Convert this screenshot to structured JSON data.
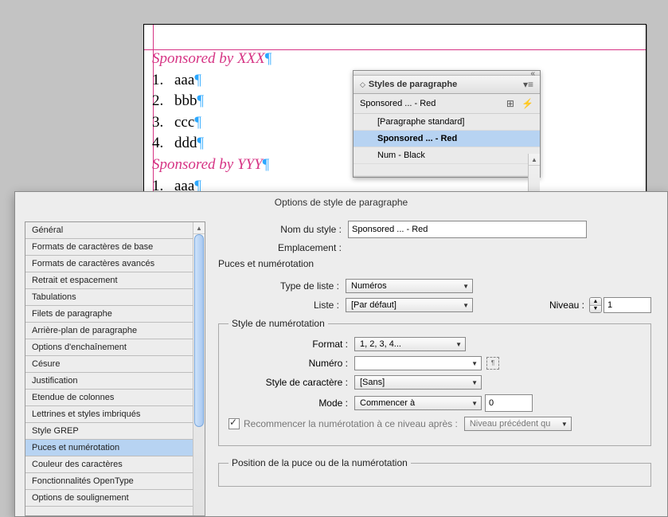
{
  "document": {
    "sponsored1": "Sponsored by XXX",
    "sponsored2": "Sponsored by YYY",
    "items1": [
      {
        "num": "1.",
        "text": "aaa"
      },
      {
        "num": "2.",
        "text": "bbb"
      },
      {
        "num": "3.",
        "text": "ccc"
      },
      {
        "num": "4.",
        "text": "ddd"
      }
    ],
    "items2": [
      {
        "num": "1.",
        "text": "aaa"
      }
    ],
    "pilcrow": "¶"
  },
  "panel": {
    "title": "Styles de paragraphe",
    "current": "Sponsored ... - Red",
    "styles": [
      {
        "name": "[Paragraphe standard]",
        "level": 1,
        "selected": false
      },
      {
        "name": "Sponsored ... - Red",
        "level": 1,
        "selected": true
      },
      {
        "name": "Num - Black",
        "level": 1,
        "selected": false
      }
    ]
  },
  "dialog": {
    "title": "Options de style de paragraphe",
    "categories": [
      "Général",
      "Formats de caractères de base",
      "Formats de caractères avancés",
      "Retrait et espacement",
      "Tabulations",
      "Filets de paragraphe",
      "Arrière-plan de paragraphe",
      "Options d'enchaînement",
      "Césure",
      "Justification",
      "Etendue de colonnes",
      "Lettrines et styles imbriqués",
      "Style GREP",
      "Puces et numérotation",
      "Couleur des caractères",
      "Fonctionnalités OpenType",
      "Options de soulignement"
    ],
    "selected_category": "Puces et numérotation",
    "labels": {
      "style_name": "Nom du style :",
      "emplacement": "Emplacement :",
      "section": "Puces et numérotation",
      "type_liste": "Type de liste :",
      "liste": "Liste :",
      "niveau": "Niveau :",
      "fieldset_num": "Style de numérotation",
      "format": "Format :",
      "numero": "Numéro :",
      "char_style": "Style de caractère :",
      "mode": "Mode :",
      "restart": "Recommencer la numérotation à ce niveau après :",
      "fieldset_pos": "Position de la puce ou de la numérotation"
    },
    "values": {
      "style_name": "Sponsored ... - Red",
      "type_liste": "Numéros",
      "liste": "[Par défaut]",
      "niveau": "1",
      "format": "1, 2, 3, 4...",
      "numero": "",
      "char_style": "[Sans]",
      "mode": "Commencer à",
      "mode_value": "0",
      "restart_after": "Niveau précédent qu"
    }
  }
}
